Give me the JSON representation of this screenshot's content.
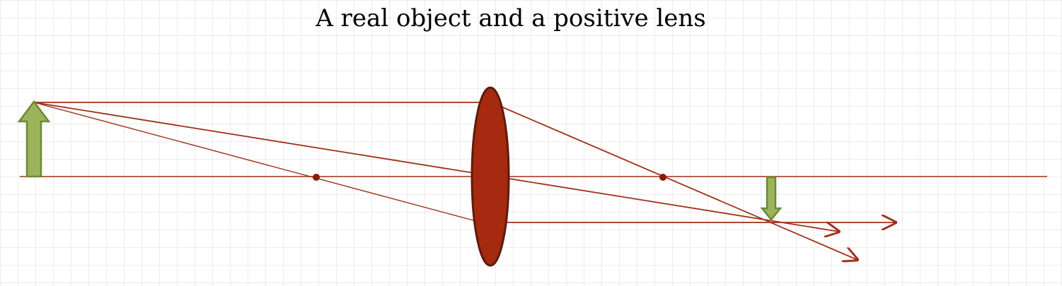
{
  "title": "A real object and a positive lens",
  "colors": {
    "ray": "#a0301a",
    "lens_fill": "#a52a10",
    "lens_stroke": "#5e1b0c",
    "arrow_fill": "#9bb35a",
    "arrow_stroke": "#6b8a36",
    "focal_point": "#8b1a0a",
    "grid": "#ececec",
    "background": "#ffffff"
  },
  "elements": {
    "object_arrow": "up-arrow-icon",
    "image_arrow": "down-arrow-icon",
    "lens": "convex-lens"
  }
}
